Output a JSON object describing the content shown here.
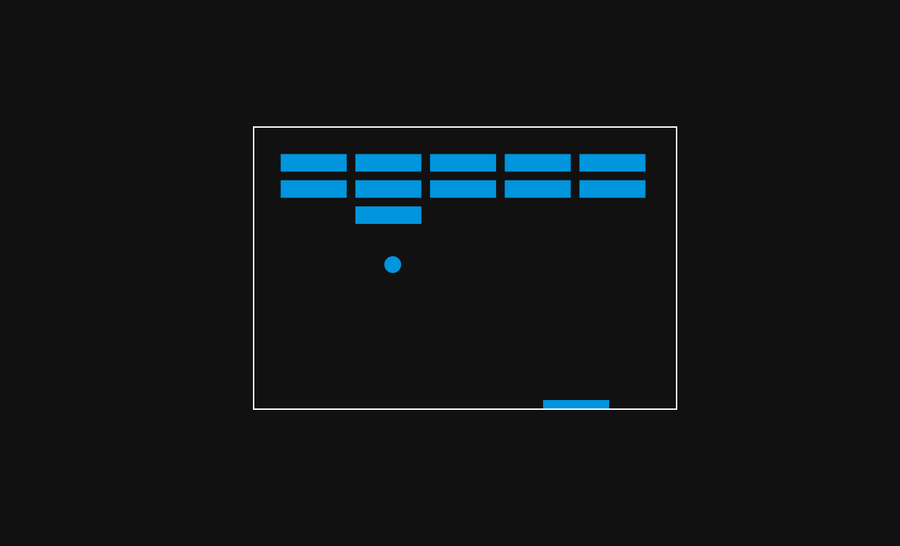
{
  "game": {
    "type": "breakout",
    "colors": {
      "background": "#111111",
      "border": "#ffffff",
      "brick": "#0095DD",
      "ball": "#0095DD",
      "paddle": "#0095DD"
    },
    "bricks": {
      "rows": 3,
      "columns": 5,
      "status": [
        [
          true,
          true,
          false
        ],
        [
          true,
          true,
          true
        ],
        [
          true,
          true,
          false
        ],
        [
          true,
          true,
          false
        ],
        [
          true,
          true,
          false
        ]
      ]
    }
  }
}
